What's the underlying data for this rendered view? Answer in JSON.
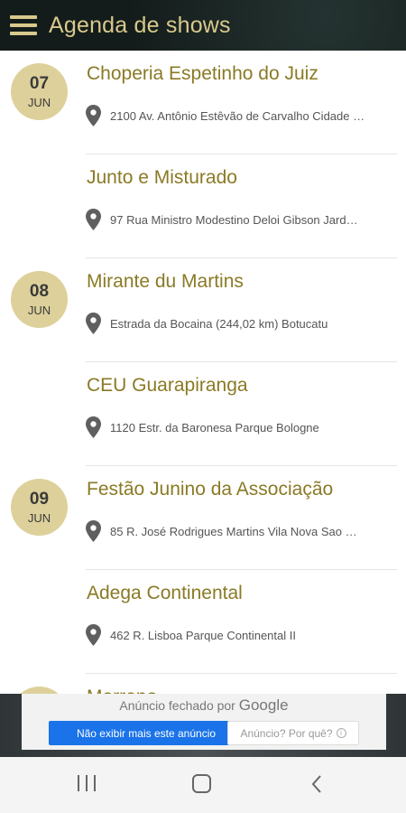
{
  "app": {
    "title": "Agenda de shows",
    "colors": {
      "appbar": "#16201f",
      "accent": "#d8c98c",
      "badge": "#ddd09a",
      "venue_text": "#8a7a25"
    }
  },
  "shows": [
    {
      "day": "07",
      "month": "JUN",
      "venue": "Choperia Espetinho do Juiz",
      "address": "2100 Av. Antônio Estêvão de Carvalho Cidade …"
    },
    {
      "day": "",
      "month": "",
      "venue": "Junto e Misturado",
      "address": "97 Rua Ministro Modestino Deloi Gibson Jard…"
    },
    {
      "day": "08",
      "month": "JUN",
      "venue": "Mirante du Martins",
      "address": "Estrada da Bocaina (244,02 km) Botucatu"
    },
    {
      "day": "",
      "month": "",
      "venue": "CEU Guarapiranga",
      "address": "1120 Estr. da Baronesa Parque Bologne"
    },
    {
      "day": "09",
      "month": "JUN",
      "venue": "Festão Junino da Associação",
      "address": "85 R. José Rodrigues Martins Vila Nova Sao …"
    },
    {
      "day": "",
      "month": "",
      "venue": "Adega Continental",
      "address": "462 R. Lisboa Parque Continental II"
    },
    {
      "day": "",
      "month": "",
      "venue": "Morreno",
      "address": ""
    }
  ],
  "ad": {
    "closed_text": "Anúncio fechado por",
    "google": "Google",
    "stop_button": "Não exibir mais este anúncio",
    "why_button": "Anúncio? Por quê?",
    "info_glyph": "i"
  },
  "navbar": {
    "icons": [
      "recent-apps-icon",
      "home-icon",
      "back-icon"
    ]
  }
}
